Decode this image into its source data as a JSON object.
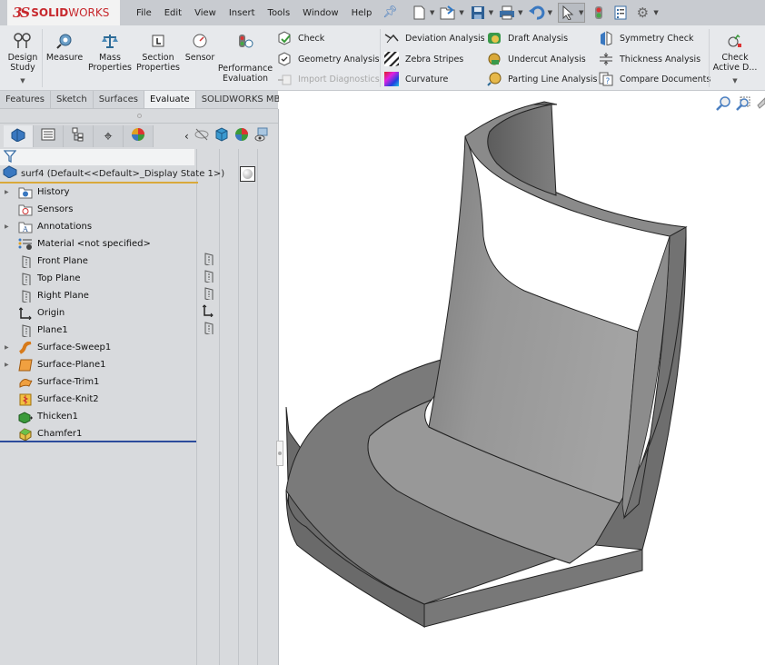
{
  "app": {
    "logo_mark": "3S",
    "logo_bold": "SOLID",
    "logo_light": "WORKS"
  },
  "menu": [
    "File",
    "Edit",
    "View",
    "Insert",
    "Tools",
    "Window",
    "Help"
  ],
  "quick_access": [
    {
      "icon": "new-document-icon"
    },
    {
      "icon": "open-icon"
    },
    {
      "icon": "save-icon"
    },
    {
      "icon": "print-icon"
    },
    {
      "icon": "undo-icon"
    },
    {
      "icon": "select-cursor-icon"
    },
    {
      "icon": "rebuild-traffic-light-icon"
    },
    {
      "icon": "file-properties-icon"
    },
    {
      "icon": "options-gear-icon"
    }
  ],
  "ribbon": {
    "design_study": "Design Study",
    "measure": "Measure",
    "mass_properties": "Mass Properties",
    "section_properties": "Section Properties",
    "sensor": "Sensor",
    "performance_evaluation": "Performance Evaluation",
    "check": "Check",
    "geometry_analysis": "Geometry Analysis",
    "import_diagnostics": "Import Diagnostics",
    "deviation_analysis": "Deviation Analysis",
    "zebra_stripes": "Zebra Stripes",
    "curvature": "Curvature",
    "draft_analysis": "Draft Analysis",
    "undercut_analysis": "Undercut Analysis",
    "parting_line_analysis": "Parting Line Analysis",
    "symmetry_check": "Symmetry Check",
    "thickness_analysis": "Thickness Analysis",
    "compare_documents": "Compare Documents",
    "check_active_doc": "Check Active D..."
  },
  "command_tabs": [
    {
      "label": "Features",
      "active": false
    },
    {
      "label": "Sketch",
      "active": false
    },
    {
      "label": "Surfaces",
      "active": false
    },
    {
      "label": "Evaluate",
      "active": true
    },
    {
      "label": "SOLIDWORKS MBD",
      "active": false
    }
  ],
  "feature_tree": {
    "root": "surf4  (Default<<Default>_Display State 1>)",
    "items": [
      {
        "label": "History",
        "icon": "history-folder-icon",
        "expandable": true
      },
      {
        "label": "Sensors",
        "icon": "sensors-folder-icon",
        "expandable": false
      },
      {
        "label": "Annotations",
        "icon": "annotations-folder-icon",
        "expandable": true
      },
      {
        "label": "Material <not specified>",
        "icon": "material-icon",
        "expandable": false
      },
      {
        "label": "Front Plane",
        "icon": "plane-icon",
        "expandable": false
      },
      {
        "label": "Top Plane",
        "icon": "plane-icon",
        "expandable": false
      },
      {
        "label": "Right Plane",
        "icon": "plane-icon",
        "expandable": false
      },
      {
        "label": "Origin",
        "icon": "origin-icon",
        "expandable": false
      },
      {
        "label": "Plane1",
        "icon": "plane-icon",
        "expandable": false
      },
      {
        "label": "Surface-Sweep1",
        "icon": "surface-sweep-icon",
        "expandable": true
      },
      {
        "label": "Surface-Plane1",
        "icon": "surface-plane-icon",
        "expandable": true
      },
      {
        "label": "Surface-Trim1",
        "icon": "surface-trim-icon",
        "expandable": false
      },
      {
        "label": "Surface-Knit2",
        "icon": "surface-knit-icon",
        "expandable": false
      },
      {
        "label": "Thicken1",
        "icon": "thicken-icon",
        "expandable": false
      },
      {
        "label": "Chamfer1",
        "icon": "chamfer-icon",
        "expandable": false
      }
    ]
  },
  "colors": {
    "brand_red": "#c7282d",
    "root_underline": "#d9a93a",
    "rollback_bar": "#2c4c9c",
    "model_light": "#9a9a9a",
    "model_dark": "#6e6e6e"
  }
}
